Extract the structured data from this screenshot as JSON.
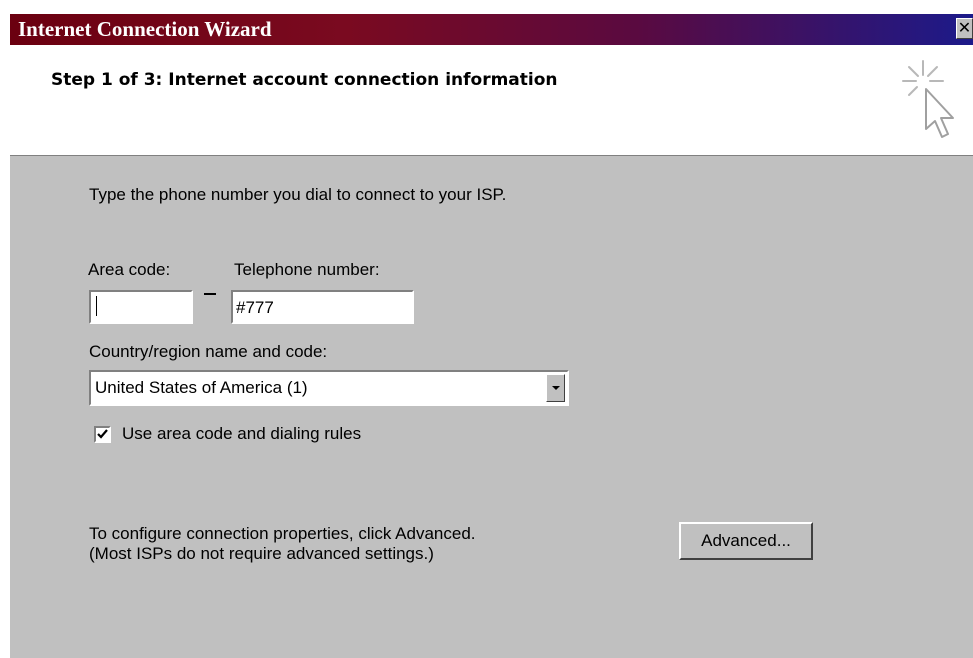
{
  "window": {
    "title": "Internet Connection Wizard",
    "close_glyph": "✕"
  },
  "header": {
    "step_title": "Step 1 of 3: Internet account connection information",
    "graphic_icon": "wizard-sparkle-cursor-icon"
  },
  "content": {
    "instruction": "Type the phone number you dial to connect to your ISP.",
    "area_code": {
      "label": "Area code:",
      "value": ""
    },
    "telephone": {
      "label": "Telephone number:",
      "value": "#777"
    },
    "country": {
      "label": "Country/region name and code:",
      "selected": "United States of America (1)"
    },
    "dialing_rules": {
      "label": "Use area code and dialing rules",
      "checked": true
    },
    "advanced_note_line1": "To configure connection properties, click Advanced.",
    "advanced_note_line2": "(Most ISPs do not require advanced settings.)",
    "advanced_button": "Advanced..."
  },
  "colors": {
    "dialog_face": "#c0c0c0",
    "header_background": "#ffffff",
    "titlebar_start": "#6b0010",
    "titlebar_end": "#1c1a8a"
  }
}
